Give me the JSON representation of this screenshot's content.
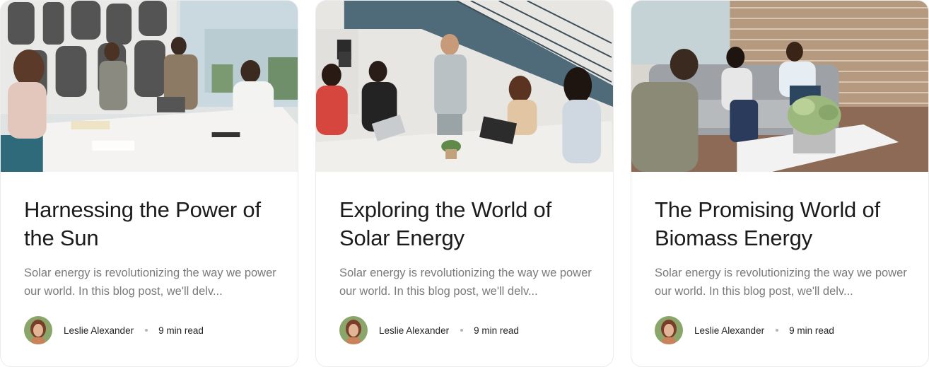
{
  "posts": [
    {
      "image_alt": "team-meeting-office-handshake",
      "title": "Harnessing the Power of the Sun",
      "excerpt": "Solar energy is revolutionizing the way we power our world. In this blog post, we'll delv...",
      "author": "Leslie Alexander",
      "read_time": "9 min read"
    },
    {
      "image_alt": "team-meeting-laptops-table",
      "title": "Exploring the World of Solar Energy",
      "excerpt": "Solar energy is revolutionizing the way we power our world. In this blog post, we'll delv...",
      "author": "Leslie Alexander",
      "read_time": "9 min read"
    },
    {
      "image_alt": "team-lounge-sofa-conversation",
      "title": "The Promising World of Biomass Energy",
      "excerpt": "Solar energy is revolutionizing the way we power our world. In this blog post, we'll delv...",
      "author": "Leslie Alexander",
      "read_time": "9 min read"
    }
  ],
  "colors": {
    "title": "#1b1b1b",
    "excerpt": "#7a7a7a",
    "meta_text": "#222222",
    "card_border": "#ececec"
  },
  "icons": {
    "meta_separator": "bullet-dot"
  }
}
